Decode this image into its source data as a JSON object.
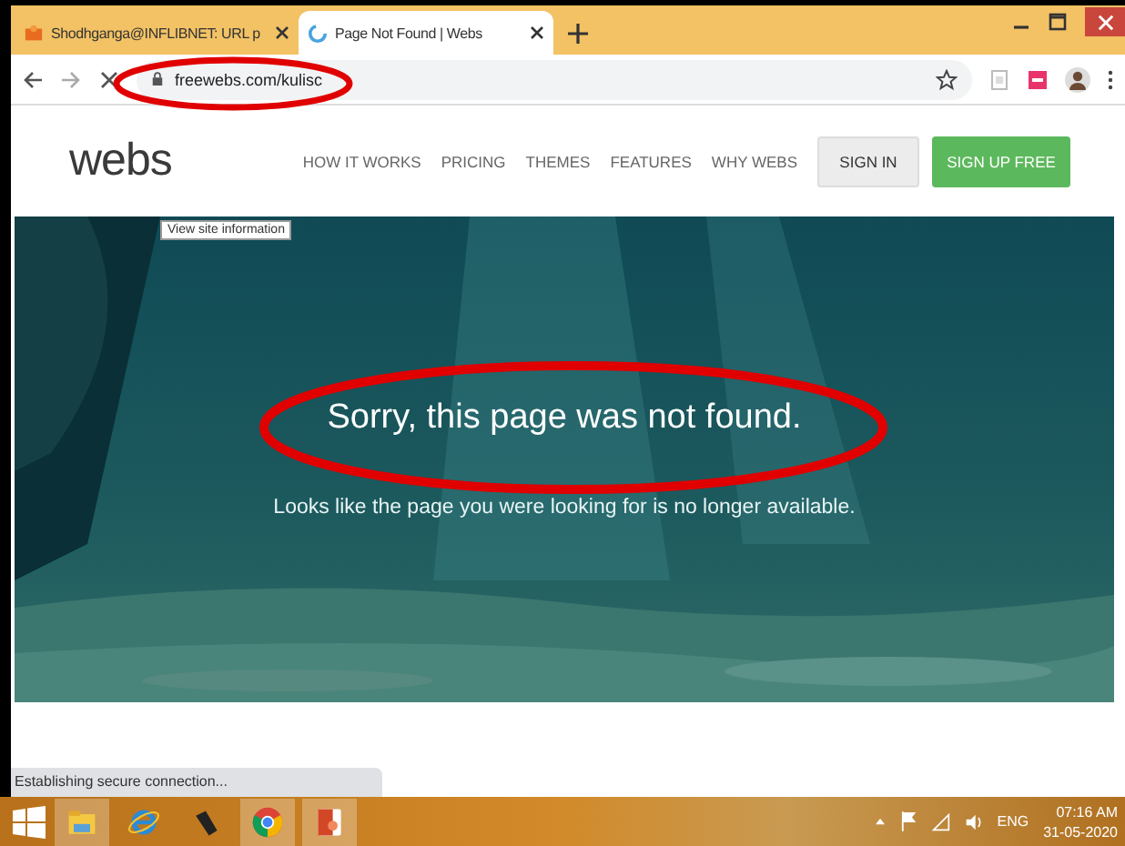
{
  "tabs": [
    {
      "title": "Shodhganga@INFLIBNET: URL p",
      "selected": false
    },
    {
      "title": "Page Not Found | Webs",
      "selected": true
    }
  ],
  "address": {
    "url": "freewebs.com/kulisc",
    "tooltip": "View site information"
  },
  "site": {
    "logo": "webs",
    "nav": [
      "HOW IT WORKS",
      "PRICING",
      "THEMES",
      "FEATURES",
      "WHY WEBS"
    ],
    "sign_in": "SIGN IN",
    "sign_up": "SIGN UP FREE"
  },
  "hero": {
    "heading": "Sorry, this page was not found.",
    "text": "Looks like the page you were looking for is no longer available."
  },
  "status_bar": "Establishing secure connection...",
  "taskbar": {
    "apps": [
      {
        "kind": "files",
        "selected": true
      },
      {
        "kind": "ie",
        "selected": false
      },
      {
        "kind": "pen",
        "selected": false
      },
      {
        "kind": "chrome",
        "selected": true
      },
      {
        "kind": "slides",
        "selected": true
      }
    ],
    "language": "ENG",
    "time": "07:16 AM",
    "date": "31-05-2020"
  }
}
